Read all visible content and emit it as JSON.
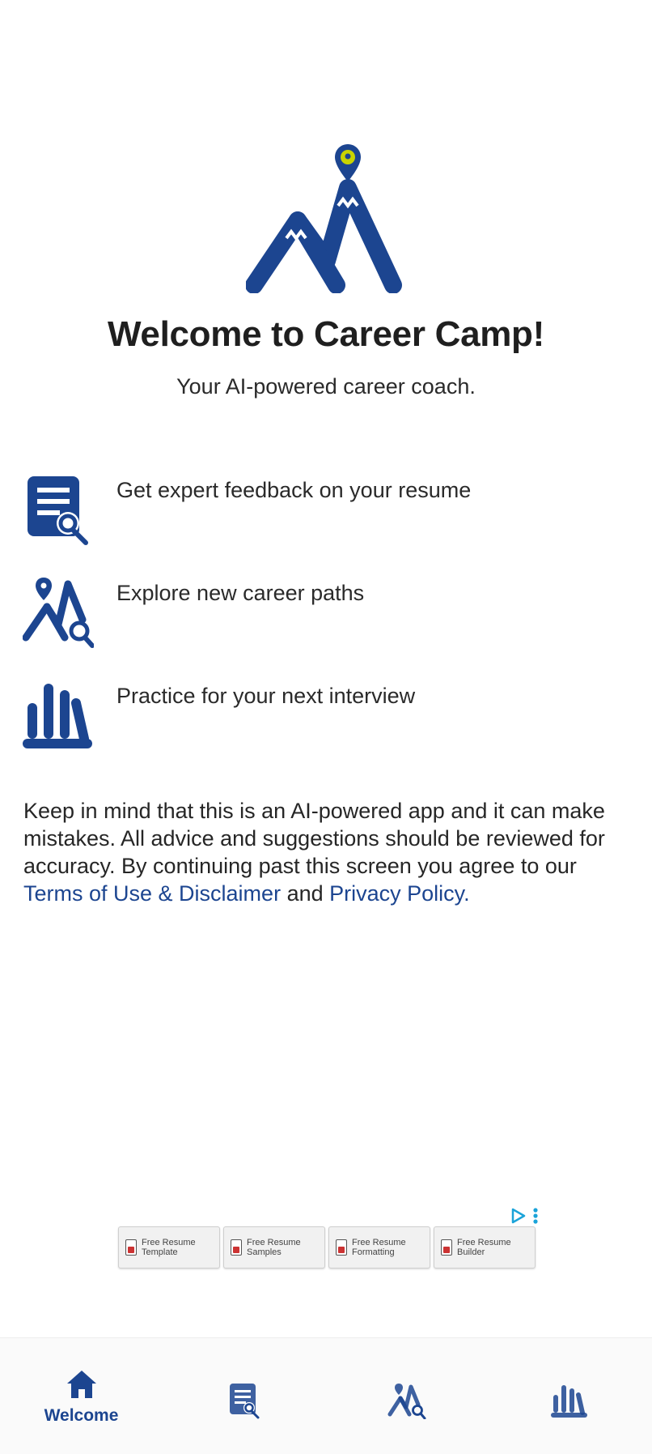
{
  "header": {
    "title": "Welcome to Career Camp!",
    "subtitle": "Your AI-powered career coach."
  },
  "features": [
    {
      "icon": "resume-search-icon",
      "label": "Get expert feedback on your resume"
    },
    {
      "icon": "career-path-search-icon",
      "label": "Explore new career paths"
    },
    {
      "icon": "interview-bars-icon",
      "label": "Practice for your next interview"
    }
  ],
  "disclaimer": {
    "text": "Keep in mind that this is an AI-powered app and it can make mistakes. All advice and suggestions should be reviewed for accuracy. By continuing past this screen you agree to our ",
    "terms_link": "Terms of Use & Disclaimer",
    "and": " and ",
    "privacy_link": "Privacy Policy",
    "end": "."
  },
  "ad": {
    "tiles": [
      "Free Resume Template",
      "Free Resume Samples",
      "Free Resume Formatting",
      "Free Resume Builder"
    ]
  },
  "bottom_nav": {
    "items": [
      {
        "icon": "home-icon",
        "label": "Welcome",
        "active": true
      },
      {
        "icon": "resume-icon",
        "label": ""
      },
      {
        "icon": "career-explore-icon",
        "label": ""
      },
      {
        "icon": "interview-icon",
        "label": ""
      }
    ]
  },
  "colors": {
    "brand": "#1c4590",
    "pin": "#c9d400",
    "text": "#222222",
    "ad_accent": "#1aa3d9"
  }
}
